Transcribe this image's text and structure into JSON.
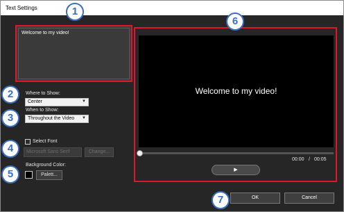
{
  "window": {
    "title": "Text Settings"
  },
  "text_input": {
    "value": "Welcome to my video!"
  },
  "where": {
    "label": "Where to Show:",
    "value": "Center"
  },
  "when": {
    "label": "When to Show:",
    "value": "Throughout the Video"
  },
  "font": {
    "checkbox_label": "Select Font",
    "value": "Microsoft Sans Serif",
    "change_label": "Change..."
  },
  "background": {
    "label": "Background Color:",
    "color": "#000000",
    "palette_label": "Palett..."
  },
  "preview": {
    "caption": "Welcome to my video!",
    "time_current": "00:00",
    "time_separator": "/",
    "time_total": "00:05",
    "play_icon": "play-icon",
    "play_glyph": "▶"
  },
  "footer": {
    "ok_label": "OK",
    "cancel_label": "Cancel"
  },
  "callouts": [
    "1",
    "2",
    "3",
    "4",
    "5",
    "6",
    "7"
  ],
  "colors": {
    "highlight": "#e0162b",
    "callout": "#3a6ec2",
    "dialog_bg": "#262626"
  }
}
